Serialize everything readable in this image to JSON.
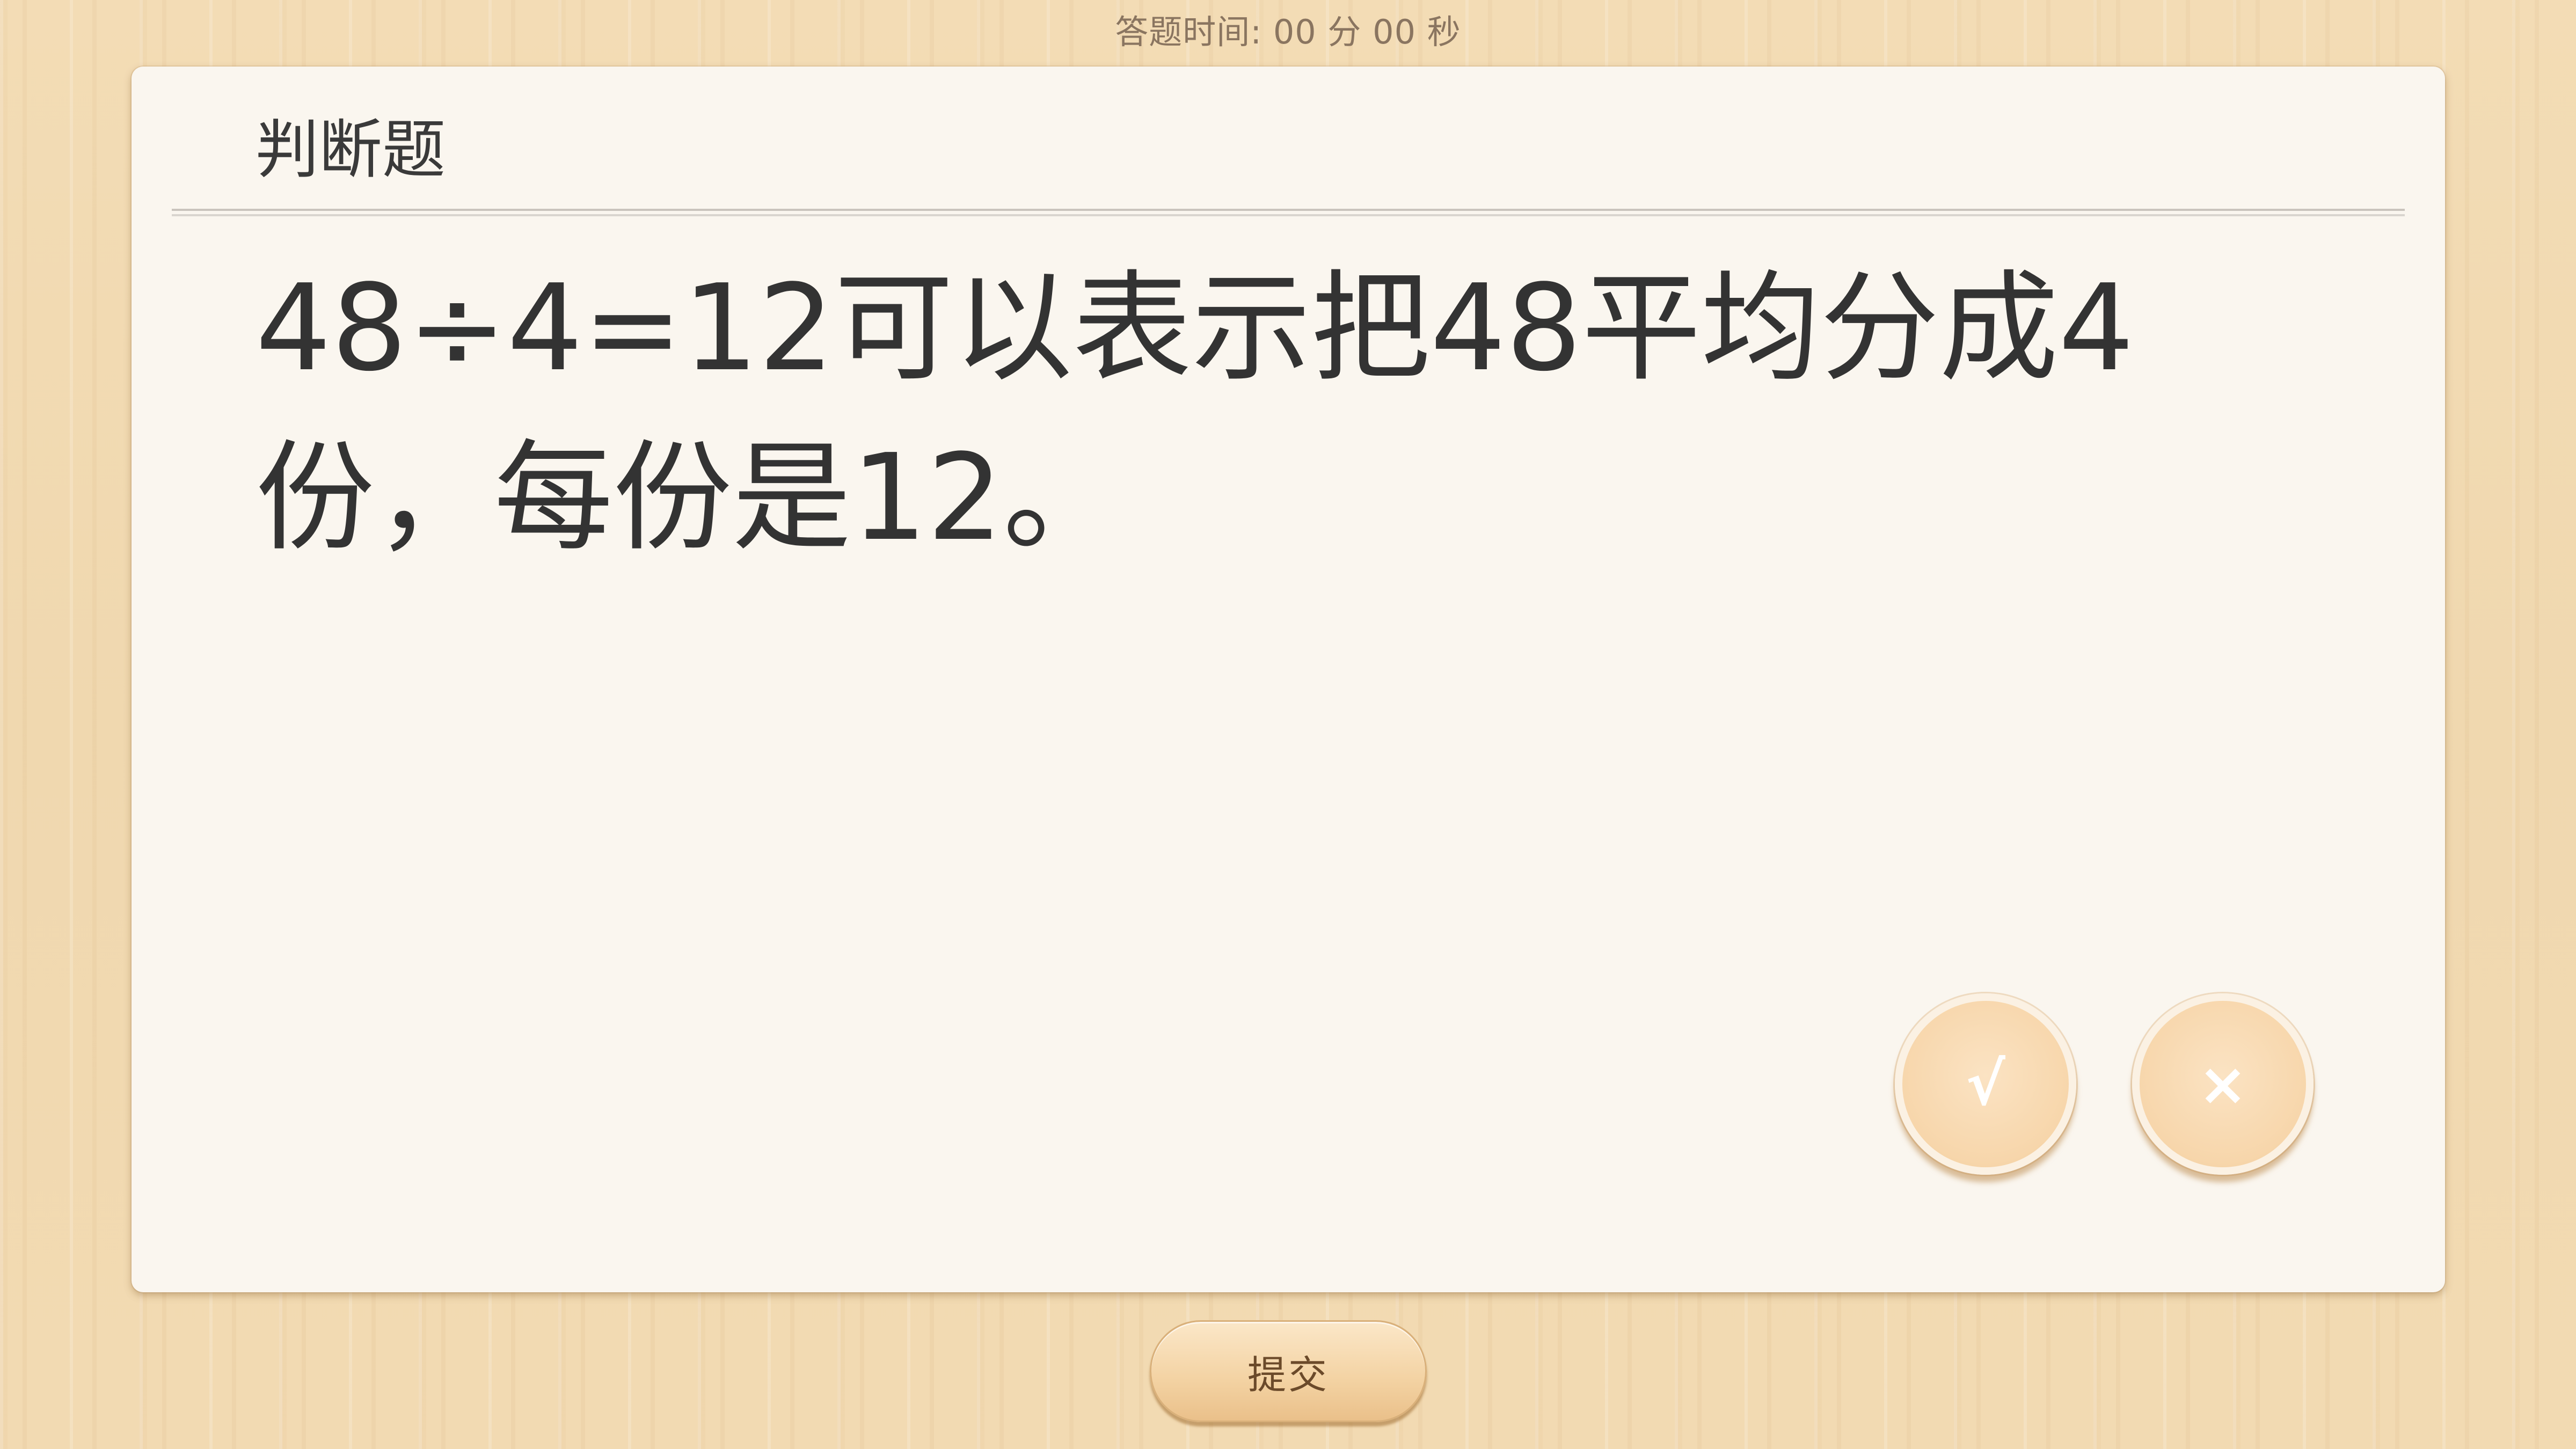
{
  "timer": {
    "text": "答题时间:  00 分 00 秒"
  },
  "card": {
    "title": "判断题",
    "question": "48÷4=12可以表示把48平均分成4份，每份是12。"
  },
  "answers": {
    "true_label": "√",
    "false_label": "×"
  },
  "submit": {
    "label": "提交"
  },
  "colors": {
    "background": "#f2dab2",
    "card": "#faf6ef",
    "button": "#f7d6ab",
    "text": "#333333"
  }
}
